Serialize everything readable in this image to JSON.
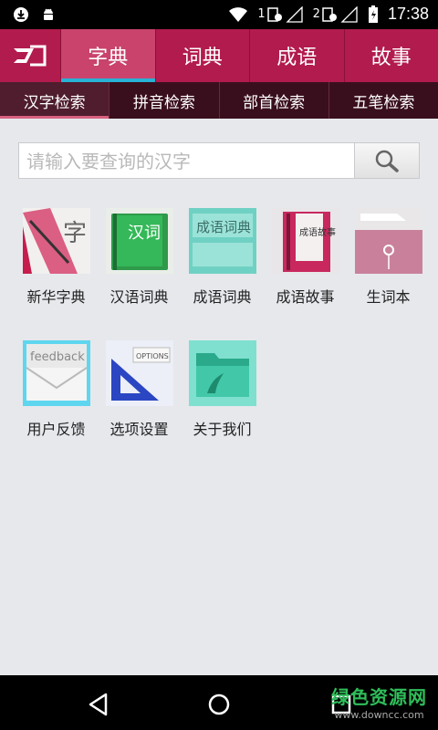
{
  "status_bar": {
    "icons": [
      "download-icon",
      "android-icon",
      "wifi-icon",
      "sim1-signal-icon",
      "sim2-signal-icon",
      "battery-charging-icon"
    ],
    "sim1_label": "1",
    "sim2_label": "2",
    "time": "17:38"
  },
  "app_bar": {
    "logo": "app-logo",
    "tabs": [
      {
        "label": "字典",
        "active": true
      },
      {
        "label": "词典",
        "active": false
      },
      {
        "label": "成语",
        "active": false
      },
      {
        "label": "故事",
        "active": false
      }
    ]
  },
  "sub_tabs": [
    {
      "label": "汉字检索",
      "active": true
    },
    {
      "label": "拼音检索",
      "active": false
    },
    {
      "label": "部首检索",
      "active": false
    },
    {
      "label": "五笔检索",
      "active": false
    }
  ],
  "search": {
    "value": "",
    "placeholder": "请输入要查询的汉字",
    "button_icon": "search-icon"
  },
  "grid": {
    "row1": [
      {
        "label": "新华字典",
        "icon": "xinhua-dictionary-icon",
        "tile_text": "字"
      },
      {
        "label": "汉语词典",
        "icon": "chinese-dictionary-icon",
        "tile_text": "汉词"
      },
      {
        "label": "成语词典",
        "icon": "idiom-dictionary-icon",
        "tile_text": "成语词典"
      },
      {
        "label": "成语故事",
        "icon": "idiom-story-icon",
        "tile_text": "成语故事"
      },
      {
        "label": "生词本",
        "icon": "new-words-notebook-icon"
      }
    ],
    "row2": [
      {
        "label": "用户反馈",
        "icon": "feedback-envelope-icon",
        "tile_text": "feedback"
      },
      {
        "label": "选项设置",
        "icon": "options-set-square-icon",
        "tile_text": "OPTIONS"
      },
      {
        "label": "关于我们",
        "icon": "about-folder-icon"
      }
    ]
  },
  "nav_bar": {
    "icons": [
      "back-icon",
      "home-icon",
      "recents-icon"
    ]
  },
  "watermark": {
    "title": "绿色资源网",
    "url": "www.downcc.com"
  },
  "colors": {
    "app_bar": "#b21b4d",
    "active_tab": "#c9436c",
    "tab_indicator": "#27b2d6",
    "sub_bar": "#3a0f1d",
    "background": "#e6e8ec",
    "watermark": "#2fbe5a"
  }
}
